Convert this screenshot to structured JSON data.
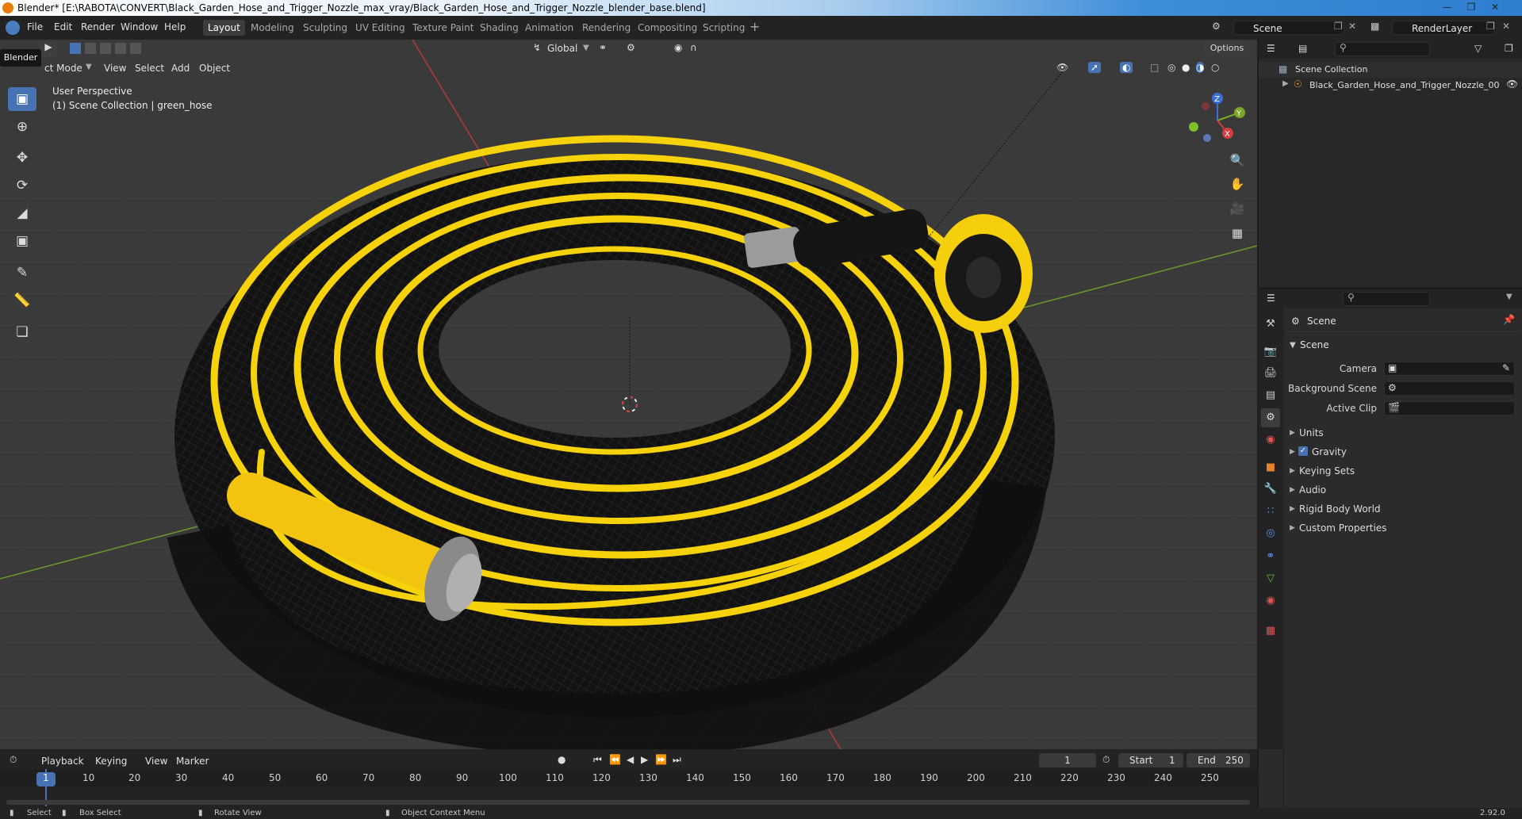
{
  "window": {
    "title": "Blender* [E:\\RABOTA\\CONVERT\\Black_Garden_Hose_and_Trigger_Nozzle_max_vray/Black_Garden_Hose_and_Trigger_Nozzle_blender_base.blend]"
  },
  "menu": [
    "File",
    "Edit",
    "Render",
    "Window",
    "Help"
  ],
  "workspaces": [
    "Layout",
    "Modeling",
    "Sculpting",
    "UV Editing",
    "Texture Paint",
    "Shading",
    "Animation",
    "Rendering",
    "Compositing",
    "Scripting"
  ],
  "scene_field": "Scene",
  "renderlayer_field": "RenderLayer",
  "tooltip": "Blender",
  "viewport_header": {
    "mode": "Object Mode",
    "mode_visible": "ct Mode",
    "items": [
      "View",
      "Select",
      "Add",
      "Object"
    ],
    "orientation": "Global",
    "options": "Options"
  },
  "viewport_overlay": {
    "line1": "User Perspective",
    "line2": "(1) Scene Collection | green_hose"
  },
  "gizmo": {
    "x": "X",
    "y": "Y",
    "z": "Z"
  },
  "outliner": {
    "root": "Scene Collection",
    "child": "Black_Garden_Hose_and_Trigger_Nozzle_00"
  },
  "properties": {
    "header": "Scene",
    "section": "Scene",
    "fields": [
      {
        "label": "Camera",
        "value": ""
      },
      {
        "label": "Background Scene",
        "value": ""
      },
      {
        "label": "Active Clip",
        "value": ""
      }
    ],
    "panels": [
      "Units",
      "Gravity",
      "Keying Sets",
      "Audio",
      "Rigid Body World",
      "Custom Properties"
    ],
    "gravity_checked": true
  },
  "timeline": {
    "menus": [
      "Playback",
      "Keying",
      "View",
      "Marker"
    ],
    "current_frame": "1",
    "start_label": "Start",
    "start": "1",
    "end_label": "End",
    "end": "250",
    "ticks": [
      "1",
      "10",
      "20",
      "30",
      "40",
      "50",
      "60",
      "70",
      "80",
      "90",
      "100",
      "110",
      "120",
      "130",
      "140",
      "150",
      "160",
      "170",
      "180",
      "190",
      "200",
      "210",
      "220",
      "230",
      "240",
      "250"
    ]
  },
  "statusbar": {
    "select": "Select",
    "box_select": "Box Select",
    "rotate": "Rotate View",
    "context": "Object Context Menu",
    "version": "2.92.0"
  },
  "colors": {
    "accent": "#4772b3",
    "hose_yellow": "#f5d20a",
    "hose_black": "#141414",
    "axis_red": "#c23a3a",
    "axis_green": "#6a9a2a"
  }
}
